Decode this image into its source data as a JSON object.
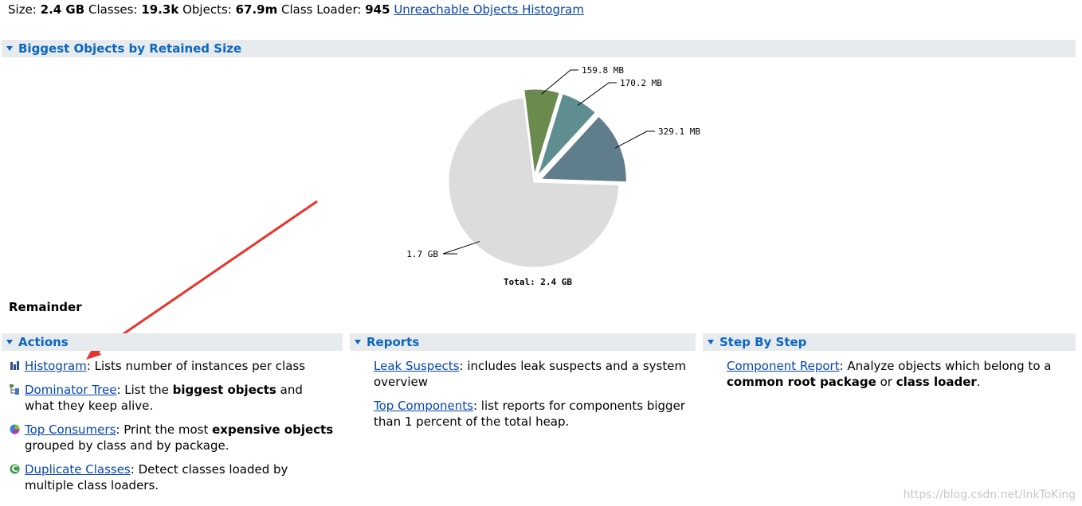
{
  "summary": {
    "size_label": "Size:",
    "size_value": "2.4 GB",
    "classes_label": "Classes:",
    "classes_value": "19.3k",
    "objects_label": "Objects:",
    "objects_value": "67.9m",
    "loader_label": "Class Loader:",
    "loader_value": "945",
    "histogram_link": "Unreachable Objects Histogram"
  },
  "biggest": {
    "title": "Biggest Objects by Retained Size",
    "total": "Total: 2.4 GB",
    "remainder_label": "Remainder"
  },
  "chart_data": {
    "type": "pie",
    "title": "",
    "total_label": "Total: 2.4 GB",
    "slices": [
      {
        "label": "159.8 MB",
        "value": 159.8,
        "color": "#6b8a4e"
      },
      {
        "label": "170.2 MB",
        "value": 170.2,
        "color": "#5f8e90"
      },
      {
        "label": "329.1 MB",
        "value": 329.1,
        "color": "#607d8b"
      },
      {
        "label": "1.7 GB",
        "value": 1740.9,
        "color": "#dcdcdc"
      }
    ]
  },
  "actions": {
    "title": "Actions",
    "items": [
      {
        "link": "Histogram",
        "text": ": Lists number of instances per class",
        "icon": "histogram-icon"
      },
      {
        "link": "Dominator Tree",
        "pre": ": List the ",
        "bold": "biggest objects",
        "post": " and what they keep alive.",
        "icon": "tree-icon"
      },
      {
        "link": "Top Consumers",
        "pre": ": Print the most ",
        "bold": "expensive objects",
        "post": " grouped by class and by package.",
        "icon": "pie-icon"
      },
      {
        "link": "Duplicate Classes",
        "text": ": Detect classes loaded by multiple class loaders.",
        "icon": "class-icon"
      }
    ]
  },
  "reports": {
    "title": "Reports",
    "items": [
      {
        "link": "Leak Suspects",
        "text": ": includes leak suspects and a system overview"
      },
      {
        "link": "Top Components",
        "text": ": list reports for components bigger than 1 percent of the total heap."
      }
    ]
  },
  "steps": {
    "title": "Step By Step",
    "link": "Component Report",
    "pre": ": Analyze objects which belong to a ",
    "bold1": "common root package",
    "mid": " or ",
    "bold2": "class loader",
    "post": "."
  },
  "watermark": "https://blog.csdn.net/InkToKing",
  "colors": {
    "section_bar": "#e8ebee",
    "section_title": "#0a66c2",
    "arrow": "#e8322b"
  }
}
